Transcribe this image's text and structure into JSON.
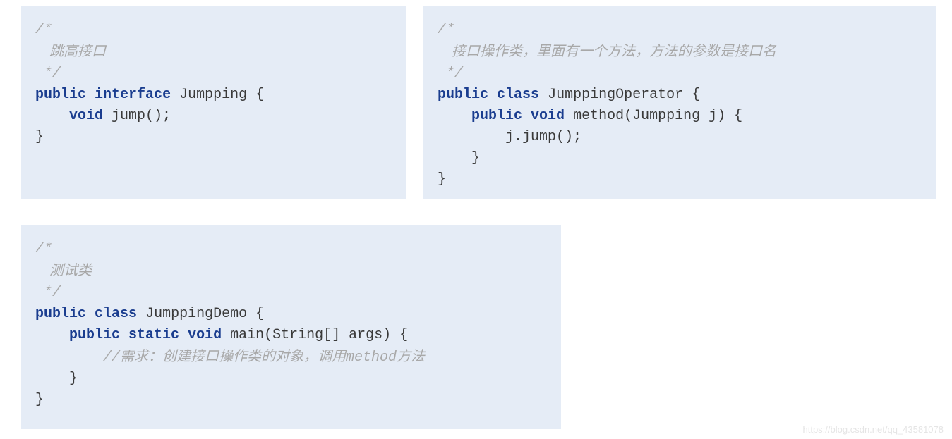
{
  "block1": {
    "c1": "/*",
    "c2": "    跳高接口",
    "c3": " */",
    "l1_kw1": "public",
    "l1_kw2": "interface",
    "l1_rest": " Jumpping {",
    "l2_kw": "void",
    "l2_rest": " jump();",
    "l3": "}"
  },
  "block2": {
    "c1": "/*",
    "c2": "    接口操作类，里面有一个方法，方法的参数是接口名",
    "c3": " */",
    "l1_kw1": "public",
    "l1_kw2": "class",
    "l1_rest": " JumppingOperator {",
    "l2_kw1": "public",
    "l2_kw2": "void",
    "l2_rest": " method(Jumpping j) {",
    "l3": "        j.jump();",
    "l4": "    }",
    "l5": "}"
  },
  "block3": {
    "c1": "/*",
    "c2": "    测试类",
    "c3": " */",
    "l1_kw1": "public",
    "l1_kw2": "class",
    "l1_rest": " JumppingDemo {",
    "l2_kw1": "public",
    "l2_kw2": "static",
    "l2_kw3": "void",
    "l2_rest": " main(String[] args) {",
    "c4a": "//",
    "c4b": "需求：创建接口操作类的对象，调用",
    "c4c": "method",
    "c4d": "方法",
    "l3": "    }",
    "l4": "}"
  },
  "watermark": "https://blog.csdn.net/qq_43581078"
}
